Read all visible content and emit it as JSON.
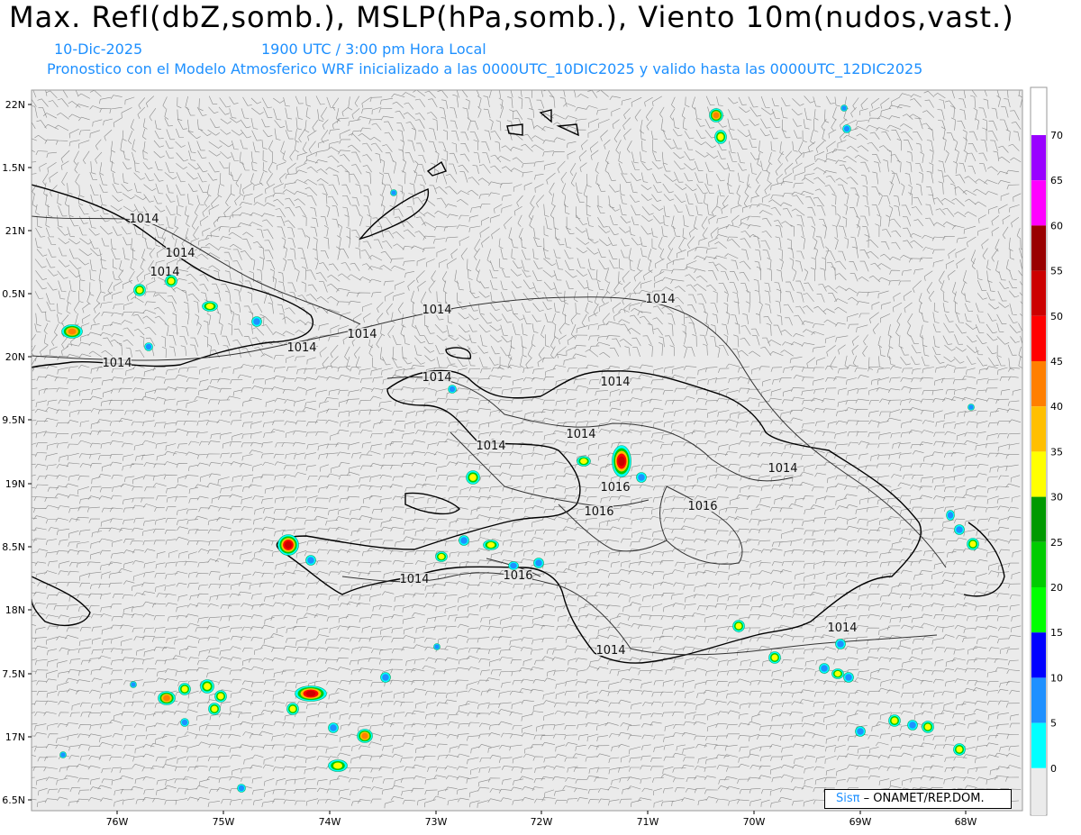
{
  "header": {
    "title": "Max. Refl(dbZ,somb.), MSLP(hPa,somb.), Viento 10m(nudos,vast.)",
    "date": "10-Dic-2025",
    "time": "1900 UTC / 3:00 pm Hora Local",
    "forecast": "Pronostico con el Modelo Atmosferico WRF inicializado a las 0000UTC_10DIC2025 y valido hasta las  0000UTC_12DIC2025"
  },
  "axes": {
    "lat_labels": [
      "22N",
      "1.5N",
      "21N",
      "0.5N",
      "20N",
      "9.5N",
      "19N",
      "8.5N",
      "18N",
      "7.5N",
      "17N",
      "6.5N"
    ],
    "lon_labels": [
      "76W",
      "75W",
      "74W",
      "73W",
      "72W",
      "71W",
      "70W",
      "69W",
      "68W"
    ]
  },
  "colorbar": {
    "ticks": [
      "70",
      "65",
      "60",
      "55",
      "50",
      "45",
      "40",
      "35",
      "30",
      "25",
      "20",
      "15",
      "10",
      "5",
      "0"
    ],
    "colors": [
      "#9900ff",
      "#ff00ff",
      "#990000",
      "#cc0000",
      "#ff0000",
      "#ff7f00",
      "#ffbf00",
      "#ffff00",
      "#009900",
      "#00cc00",
      "#00ff00",
      "#0000ff",
      "#1e90ff",
      "#00ffff"
    ]
  },
  "isobars": [
    {
      "text": "1014"
    },
    {
      "text": "1014"
    },
    {
      "text": "1014"
    },
    {
      "text": "1014"
    },
    {
      "text": "1014"
    },
    {
      "text": "1014"
    },
    {
      "text": "1014"
    },
    {
      "text": "1014"
    },
    {
      "text": "1014"
    },
    {
      "text": "1014"
    },
    {
      "text": "1014"
    },
    {
      "text": "1014"
    },
    {
      "text": "1014"
    },
    {
      "text": "1014"
    },
    {
      "text": "1014"
    },
    {
      "text": "1014"
    },
    {
      "text": "1016"
    },
    {
      "text": "1016"
    },
    {
      "text": "1016"
    },
    {
      "text": "1016"
    }
  ],
  "credit": {
    "logo": "Sisπ",
    "text": "– ONAMET/REP.DOM."
  }
}
